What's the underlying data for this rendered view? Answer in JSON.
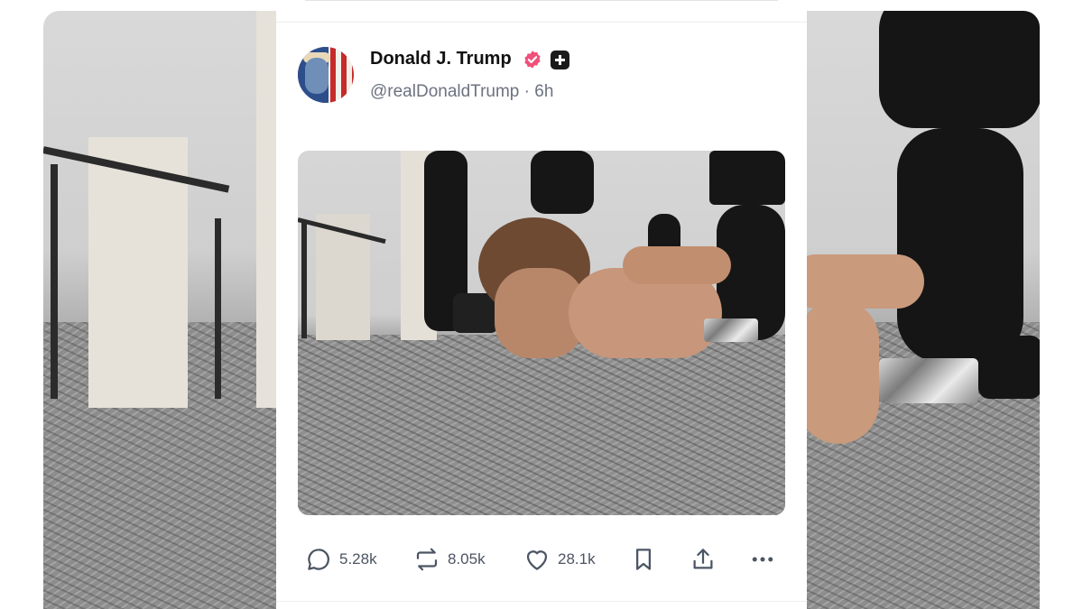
{
  "post": {
    "author_name": "Donald J. Trump",
    "handle": "@realDonaldTrump",
    "separator": "·",
    "time_ago": "6h",
    "badges": [
      "verified-badge-icon",
      "plus-badge-icon"
    ],
    "image_alt": ""
  },
  "actions": {
    "replies": "5.28k",
    "reposts": "8.05k",
    "likes": "28.1k"
  },
  "colors": {
    "verified": "#f0507a",
    "text_primary": "#111111",
    "text_secondary": "#6b7280"
  }
}
